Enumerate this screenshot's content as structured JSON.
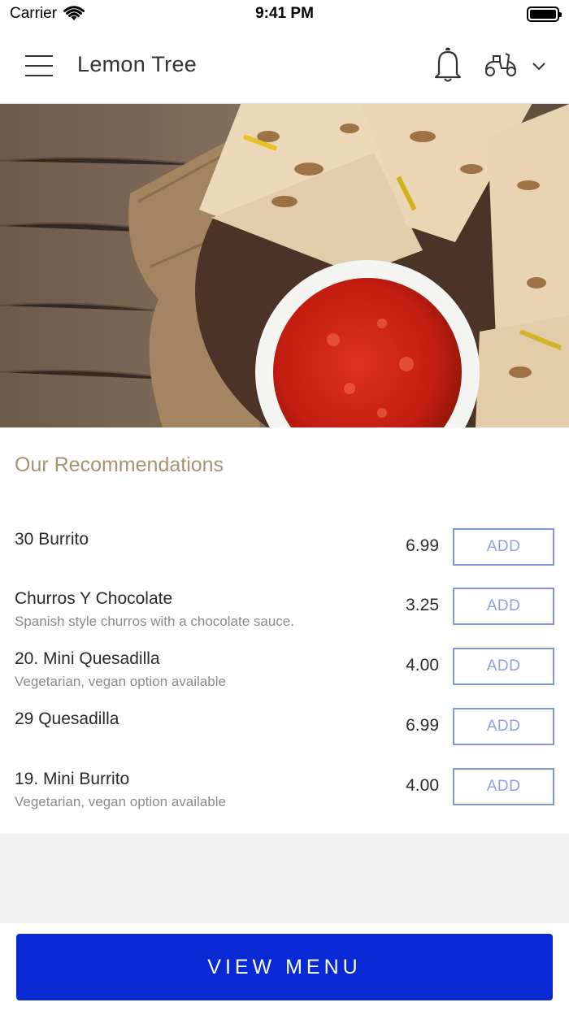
{
  "status_bar": {
    "carrier": "Carrier",
    "time": "9:41 PM"
  },
  "header": {
    "title": "Lemon Tree",
    "icons": [
      "menu-icon",
      "bell-icon",
      "scooter-icon",
      "chevron-down-icon"
    ]
  },
  "hero": {
    "icon": "quesadilla-salsa-photo"
  },
  "recommendations": {
    "title": "Our Recommendations",
    "items": [
      {
        "name": "30 Burrito",
        "description": "",
        "price": "6.99",
        "button": "ADD"
      },
      {
        "name": "Churros Y Chocolate",
        "description": "Spanish style churros with a chocolate sauce.",
        "price": "3.25",
        "button": "ADD"
      },
      {
        "name": "20. Mini Quesadilla",
        "description": "Vegetarian, vegan option available",
        "price": "4.00",
        "button": "ADD"
      },
      {
        "name": "29 Quesadilla",
        "description": "",
        "price": "6.99",
        "button": "ADD"
      },
      {
        "name": "19. Mini Burrito",
        "description": "Vegetarian, vegan option available",
        "price": "4.00",
        "button": "ADD"
      }
    ]
  },
  "footer": {
    "view_menu_label": "VIEW MENU"
  },
  "colors": {
    "accent_blue": "#0829d4",
    "add_border": "#7f95de",
    "section_title": "#a59371"
  }
}
